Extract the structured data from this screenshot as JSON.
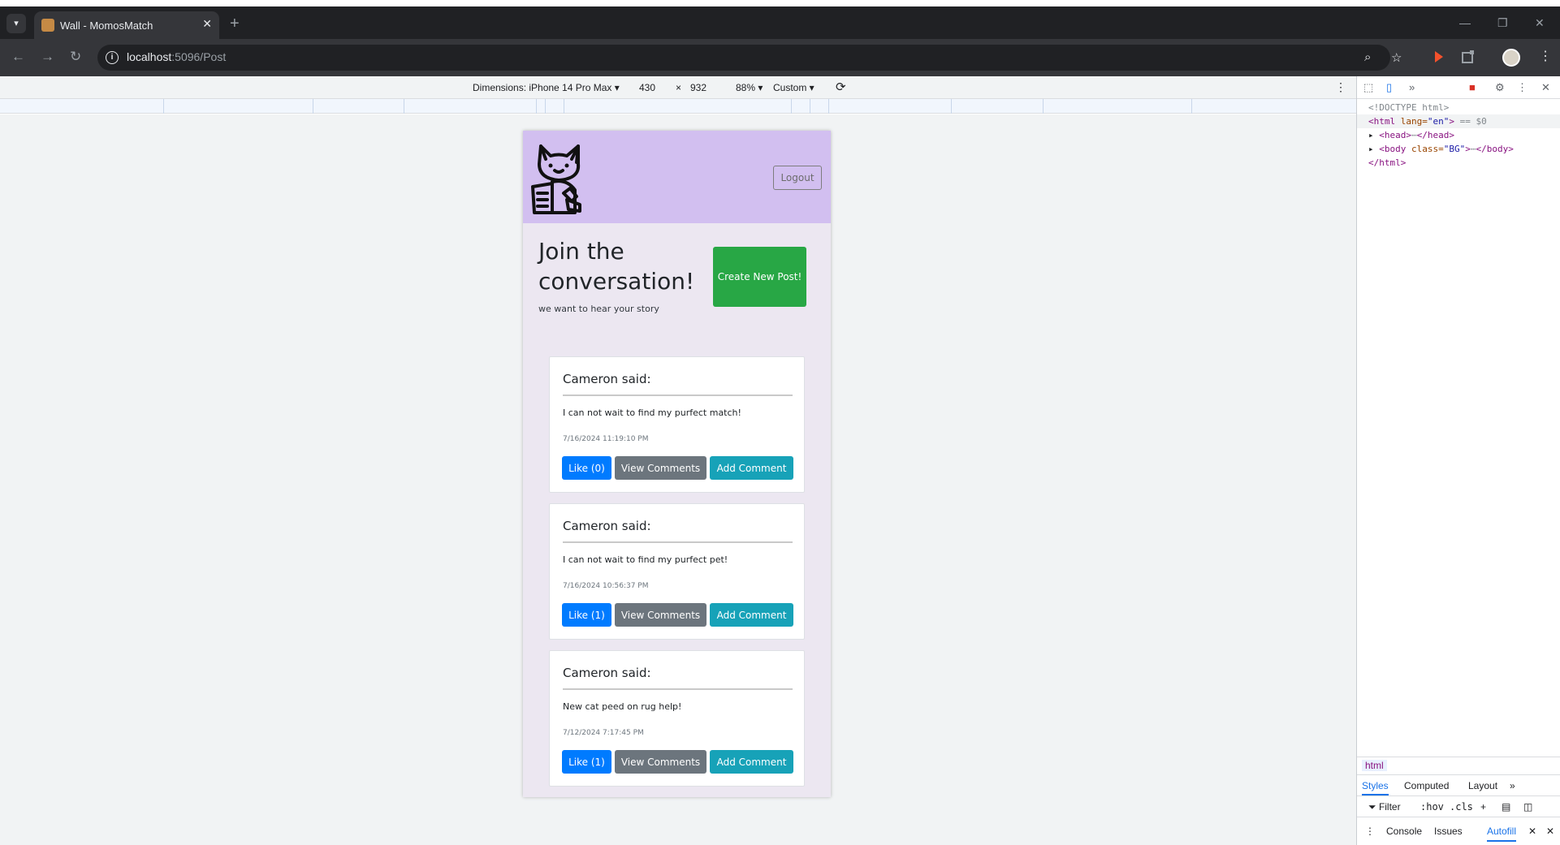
{
  "browser": {
    "tab_title": "Wall - MomosMatch",
    "url_host": "localhost",
    "url_rest": ":5096/Post",
    "new_tab": "+",
    "tab_close": "✕"
  },
  "device_toolbar": {
    "dimensions_label": "Dimensions: iPhone 14 Pro Max",
    "width": "430",
    "times": "×",
    "height": "932",
    "zoom": "88%",
    "throttle": "Custom"
  },
  "app": {
    "logout_label": "Logout",
    "hero_title": "Join the conversation!",
    "hero_subtitle": "we want to hear your story",
    "create_post_label": "Create New Post!",
    "posts": [
      {
        "author": "Cameron said:",
        "body": "I can not wait to find my purfect match!",
        "date": "7/16/2024 11:19:10 PM",
        "like_label": "Like (0)",
        "view_label": "View Comments",
        "add_label": "Add Comment"
      },
      {
        "author": "Cameron said:",
        "body": "I can not wait to find my purfect pet!",
        "date": "7/16/2024 10:56:37 PM",
        "like_label": "Like (1)",
        "view_label": "View Comments",
        "add_label": "Add Comment"
      },
      {
        "author": "Cameron said:",
        "body": "New cat peed on rug help!",
        "date": "7/12/2024 7:17:45 PM",
        "like_label": "Like (1)",
        "view_label": "View Comments",
        "add_label": "Add Comment"
      }
    ]
  },
  "devtools": {
    "doctype": "<!DOCTYPE html>",
    "html_open_tag": "<html",
    "html_lang_attr": " lang=",
    "html_lang_val": "\"en\"",
    "html_close_bracket": ">",
    "selected_marker": " == $0",
    "head_line": "<head>",
    "head_close": "</head>",
    "body_open": "<body",
    "body_attr": " class=",
    "body_val": "\"BG\"",
    "body_close": "</body>",
    "html_close": "</html>",
    "ellipsis": "⋯",
    "breadcrumb": "html",
    "tabs": [
      "Styles",
      "Computed",
      "Layout"
    ],
    "filter_label": "Filter",
    "hov": ":hov",
    "cls": ".cls",
    "drawer_tabs": [
      "Console",
      "Issues",
      "Autofill"
    ]
  }
}
